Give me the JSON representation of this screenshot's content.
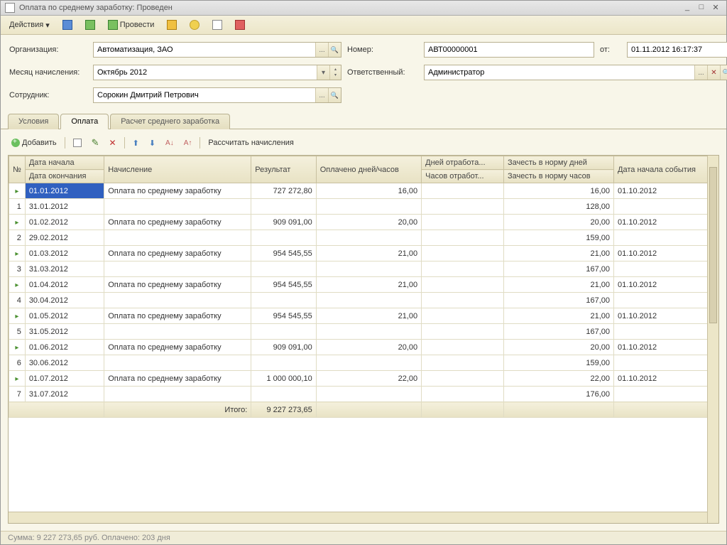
{
  "window_title": "Оплата по среднему заработку: Проведен",
  "toolbar": {
    "actions_label": "Действия",
    "post_label": "Провести"
  },
  "form": {
    "org_label": "Организация:",
    "org_value": "Автоматизация, ЗАО",
    "month_label": "Месяц начисления:",
    "month_value": "Октябрь 2012",
    "emp_label": "Сотрудник:",
    "emp_value": "Сорокин Дмитрий Петрович",
    "num_label": "Номер:",
    "num_value": "АВТ00000001",
    "from_label": "от:",
    "date_value": "01.11.2012 16:17:37",
    "resp_label": "Ответственный:",
    "resp_value": "Администратор"
  },
  "tabs": {
    "t1": "Условия",
    "t2": "Оплата",
    "t3": "Расчет среднего заработка"
  },
  "grid_toolbar": {
    "add_label": "Добавить",
    "calc_label": "Рассчитать начисления"
  },
  "columns": {
    "num": "№",
    "date_start": "Дата начала",
    "date_end": "Дата окончания",
    "accrual": "Начисление",
    "result": "Результат",
    "paid": "Оплачено дней/часов",
    "days_worked": "Дней отработа...",
    "hours_worked": "Часов отработ...",
    "norm_days": "Зачесть в норму дней",
    "norm_hours": "Зачесть в норму часов",
    "event_date": "Дата начала события"
  },
  "rows": [
    {
      "n": "1",
      "ds": "01.01.2012",
      "de": "31.01.2012",
      "accr": "Оплата по среднему заработку",
      "res": "727 272,80",
      "paid": "16,00",
      "nd": "16,00",
      "nh": "128,00",
      "ev": "01.10.2012"
    },
    {
      "n": "2",
      "ds": "01.02.2012",
      "de": "29.02.2012",
      "accr": "Оплата по среднему заработку",
      "res": "909 091,00",
      "paid": "20,00",
      "nd": "20,00",
      "nh": "159,00",
      "ev": "01.10.2012"
    },
    {
      "n": "3",
      "ds": "01.03.2012",
      "de": "31.03.2012",
      "accr": "Оплата по среднему заработку",
      "res": "954 545,55",
      "paid": "21,00",
      "nd": "21,00",
      "nh": "167,00",
      "ev": "01.10.2012"
    },
    {
      "n": "4",
      "ds": "01.04.2012",
      "de": "30.04.2012",
      "accr": "Оплата по среднему заработку",
      "res": "954 545,55",
      "paid": "21,00",
      "nd": "21,00",
      "nh": "167,00",
      "ev": "01.10.2012"
    },
    {
      "n": "5",
      "ds": "01.05.2012",
      "de": "31.05.2012",
      "accr": "Оплата по среднему заработку",
      "res": "954 545,55",
      "paid": "21,00",
      "nd": "21,00",
      "nh": "167,00",
      "ev": "01.10.2012"
    },
    {
      "n": "6",
      "ds": "01.06.2012",
      "de": "30.06.2012",
      "accr": "Оплата по среднему заработку",
      "res": "909 091,00",
      "paid": "20,00",
      "nd": "20,00",
      "nh": "159,00",
      "ev": "01.10.2012"
    },
    {
      "n": "7",
      "ds": "01.07.2012",
      "de": "31.07.2012",
      "accr": "Оплата по среднему заработку",
      "res": "1 000 000,10",
      "paid": "22,00",
      "nd": "22,00",
      "nh": "176,00",
      "ev": "01.10.2012"
    }
  ],
  "totals": {
    "label": "Итого:",
    "result": "9 227 273,65"
  },
  "status": "Сумма: 9 227 273,65 руб.  Оплачено: 203 дня"
}
